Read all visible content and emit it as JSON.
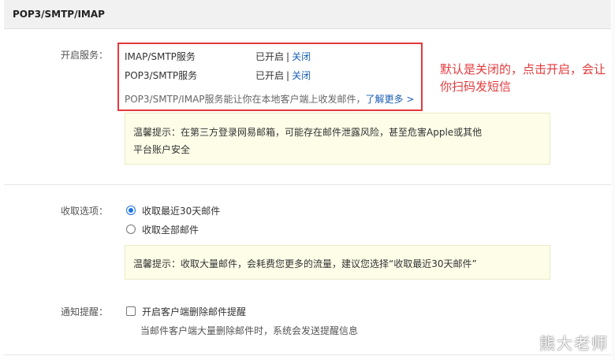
{
  "section": {
    "title": "POP3/SMTP/IMAP"
  },
  "services": {
    "label": "开启服务：",
    "items": [
      {
        "name": "IMAP/SMTP服务",
        "status": "已开启",
        "separator": "|",
        "action": "关闭"
      },
      {
        "name": "POP3/SMTP服务",
        "status": "已开启",
        "separator": "|",
        "action": "关闭"
      }
    ],
    "description": "POP3/SMTP/IMAP服务能让你在本地客户端上收发邮件，",
    "learn_more": "了解更多 >",
    "tip_line1": "温馨提示：在第三方登录网易邮箱，可能存在邮件泄露风险，甚至危害Apple或其他",
    "tip_line2": "平台账户安全"
  },
  "annotation": {
    "text": "默认是关闭的，点击开启，会让你扫码发短信",
    "color": "#e4393c"
  },
  "receive": {
    "label": "收取选项：",
    "options": [
      {
        "label": "收取最近30天邮件",
        "checked": true
      },
      {
        "label": "收取全部邮件",
        "checked": false
      }
    ],
    "tip": "温馨提示：收取大量邮件，会耗费您更多的流量，建议您选择“收取最近30天邮件”"
  },
  "notify": {
    "label": "通知提醒：",
    "checkbox_label": "开启客户端删除邮件提醒",
    "checked": false,
    "description": "当邮件客户端大量删除邮件时，系统会发送提醒信息"
  },
  "watermark": {
    "text": "熊大老师"
  },
  "colors": {
    "link": "#1a5fb4",
    "highlight_border": "#e4393c",
    "tip_bg": "#fdfde8",
    "radio_accent": "#1a73e8"
  }
}
